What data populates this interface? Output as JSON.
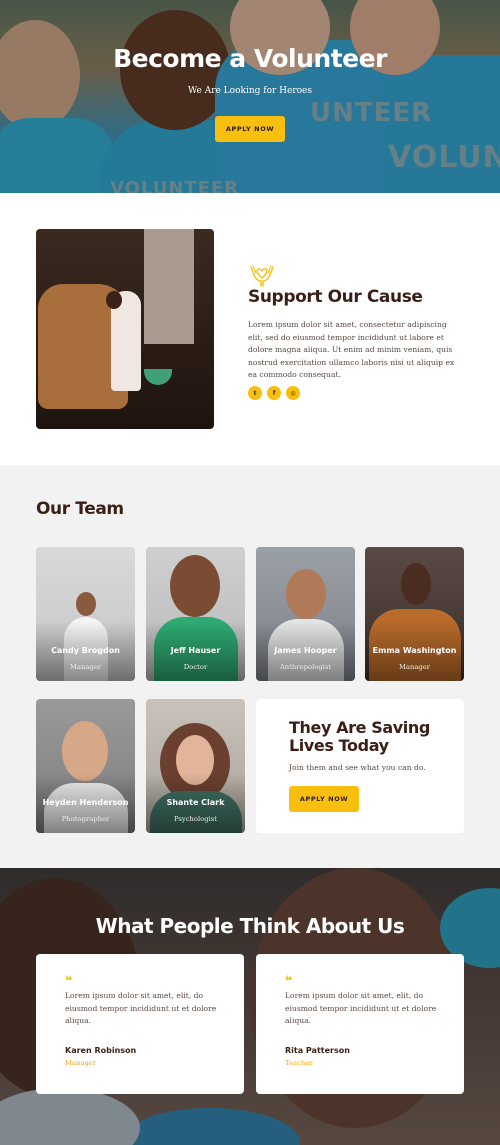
{
  "hero": {
    "title": "Become a Volunteer",
    "subtitle": "We Are Looking for Heroes",
    "button_label": "APPLY NOW",
    "shirt_texts": [
      "VOLUNTEER",
      "UNTEER",
      "VOLUNTEER"
    ]
  },
  "support": {
    "title": "Support Our Cause",
    "text": "Lorem ipsum dolor sit amet, consectetur adipiscing elit, sed do eiusmod tempor incididunt ut labore et dolore magna aliqua. Ut enim ad minim veniam, quis nostrud exercitation ullamco laboris nisi ut aliquip ex ea commodo consequat.",
    "social": [
      {
        "icon": "twitter-icon",
        "glyph": "t"
      },
      {
        "icon": "facebook-icon",
        "glyph": "f"
      },
      {
        "icon": "instagram-icon",
        "glyph": "◎"
      }
    ]
  },
  "team": {
    "title": "Our Team",
    "members": [
      {
        "name": "Candy Brogdon",
        "role": "Manager"
      },
      {
        "name": "Jeff Hauser",
        "role": "Doctor"
      },
      {
        "name": "James Hooper",
        "role": "Anthropologist"
      },
      {
        "name": "Emma Washington",
        "role": "Manager"
      },
      {
        "name": "Heyden Henderson",
        "role": "Photographer"
      },
      {
        "name": "Shante Clark",
        "role": "Psychologist"
      }
    ],
    "cta": {
      "title": "They Are Saving Lives Today",
      "text": "Join them and see what you can do.",
      "button_label": "APPLY NOW"
    }
  },
  "testimonials": {
    "title": "What People Think About Us",
    "quote_glyph": "❝",
    "items": [
      {
        "quote": "Lorem ipsum dolor sit amet, elit, do eiusmod tempor incididunt ut et dolore aliqua.",
        "name": "Karen Robinson",
        "role": "Manager"
      },
      {
        "quote": "Lorem ipsum dolor sit amet, elit, do eiusmod tempor incididunt ut et dolore aliqua.",
        "name": "Rita Patterson",
        "role": "Teacher"
      }
    ]
  },
  "colors": {
    "accent": "#f9bf0f",
    "heading": "#3b1f16",
    "body_text": "#5a4a44",
    "team_bg": "#f2f2f2"
  }
}
